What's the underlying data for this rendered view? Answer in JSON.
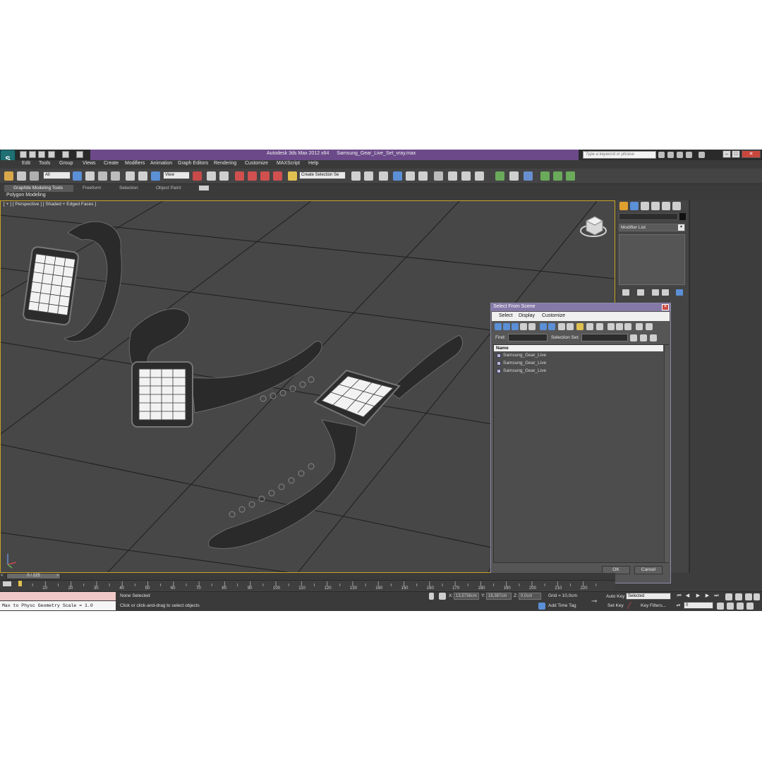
{
  "titlebar": {
    "app_name": "Autodesk 3ds Max  2012 x64",
    "file_name": "Samsung_Gear_Live_Set_vray.max",
    "search_placeholder": "Type a keyword or phrase"
  },
  "menu": [
    {
      "label": "Edit"
    },
    {
      "label": "Tools"
    },
    {
      "label": "Group"
    },
    {
      "label": "Views"
    },
    {
      "label": "Create"
    },
    {
      "label": "Modifiers"
    },
    {
      "label": "Animation"
    },
    {
      "label": "Graph Editors"
    },
    {
      "label": "Rendering"
    },
    {
      "label": "Customize"
    },
    {
      "label": "MAXScript"
    },
    {
      "label": "Help"
    }
  ],
  "toolbar": {
    "filter_value": "All",
    "refcoord_value": "View",
    "named_selection_value": "Create Selection Se"
  },
  "ribbon": {
    "tabs": [
      "Graphite Modeling Tools",
      "Freeform",
      "Selection",
      "Object Paint"
    ],
    "panel_label": "Polygon Modeling"
  },
  "viewport": {
    "label": "[ + ] [ Perspective ] [ Shaded + Edged Faces ]"
  },
  "command_panel": {
    "modifier_list_label": "Modifier List"
  },
  "dialog": {
    "title": "Select From Scene",
    "menu": [
      "Select",
      "Display",
      "Customize"
    ],
    "find_label": "Find:",
    "selection_set_label": "Selection Set:",
    "column_header": "Name",
    "rows": [
      {
        "name": "Samsung_Gear_Live"
      },
      {
        "name": "Samsung_Gear_Live"
      },
      {
        "name": "Samsung_Gear_Live"
      }
    ],
    "ok_label": "OK",
    "cancel_label": "Cancel"
  },
  "timeline": {
    "slider_label": "0 / 225",
    "ticks": [
      "10",
      "20",
      "30",
      "40",
      "50",
      "60",
      "70",
      "80",
      "90",
      "100",
      "110",
      "120",
      "130",
      "140",
      "150",
      "160",
      "170",
      "180",
      "190",
      "200",
      "210",
      "220"
    ]
  },
  "status": {
    "maxscript_output": "Max to Physc Geometry Scale = 1.0",
    "selection_status": "None Selected",
    "prompt": "Click or click-and-drag to select objects",
    "x_label": "X:",
    "x_value": "13,5738cm",
    "y_label": "Y:",
    "y_value": "18,387cm",
    "z_label": "Z:",
    "z_value": "0,0cm",
    "grid": "Grid = 10,0cm",
    "add_time_tag": "Add Time Tag",
    "auto_key": "Auto Key",
    "set_key": "Set Key",
    "key_mode_value": "Selected",
    "key_filters": "Key Filters...",
    "current_frame": "0"
  }
}
